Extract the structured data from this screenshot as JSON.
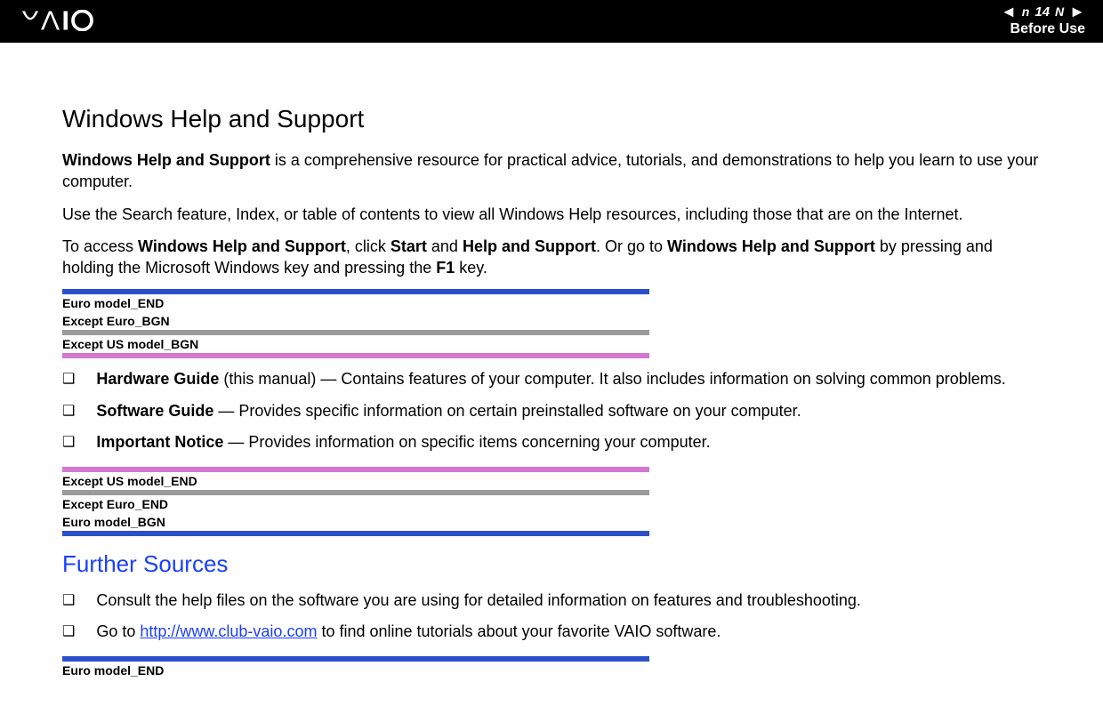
{
  "header": {
    "page_number": "14",
    "nav_letter": "n",
    "nav_letter_right": "N",
    "breadcrumb": "Before Use"
  },
  "section1": {
    "title": "Windows Help and Support",
    "p1_b1": "Windows Help and Support",
    "p1_rest": " is a comprehensive resource for practical advice, tutorials, and demonstrations to help you learn to use your computer.",
    "p2": "Use the Search feature, Index, or table of contents to view all Windows Help resources, including those that are on the Internet.",
    "p3_a": "To access ",
    "p3_b1": "Windows Help and Support",
    "p3_b": ", click ",
    "p3_b2": "Start",
    "p3_c": " and ",
    "p3_b3": "Help and Support",
    "p3_d": ". Or go to ",
    "p3_b4": "Windows Help and Support",
    "p3_e": " by pressing and holding the Microsoft Windows key and pressing the ",
    "p3_b5": "F1",
    "p3_f": " key."
  },
  "markers1": {
    "l1": "Euro model_END",
    "l2": "Except Euro_BGN",
    "l3": "Except US model_BGN"
  },
  "bullets1": [
    {
      "bold": "Hardware Guide",
      "rest": " (this manual) — Contains features of your computer. It also includes information on solving common problems."
    },
    {
      "bold": "Software Guide",
      "rest": " — Provides specific information on certain preinstalled software on your computer."
    },
    {
      "bold": "Important Notice",
      "rest": " — Provides information on specific items concerning your computer."
    }
  ],
  "markers2": {
    "l1": "Except US model_END",
    "l2": "Except Euro_END",
    "l3": "Euro model_BGN"
  },
  "section2": {
    "title": "Further Sources"
  },
  "bullets2": [
    {
      "text_a": "Consult the help files on the software you are using for detailed information on features and troubleshooting."
    },
    {
      "text_a": "Go to ",
      "link_text": "http://www.club-vaio.com",
      "link_href": "http://www.club-vaio.com",
      "text_b": " to find online tutorials about your favorite VAIO software."
    }
  ],
  "markers3": {
    "l1": "Euro model_END"
  }
}
